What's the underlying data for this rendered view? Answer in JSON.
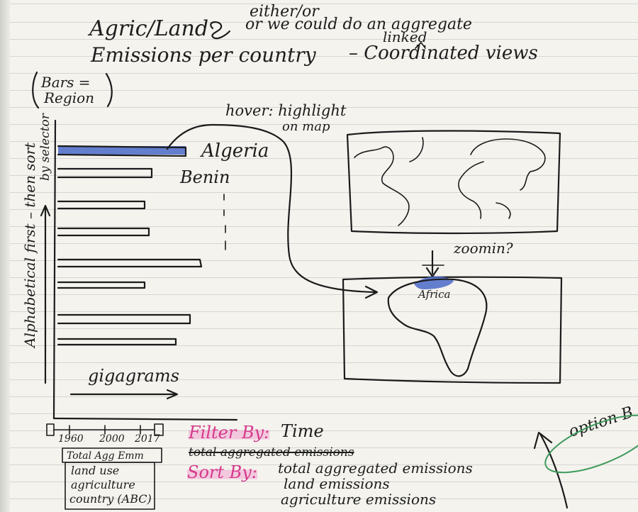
{
  "title": {
    "line1": "Agric/Land",
    "either_or_top": "either/or",
    "either_or_bottom": "or we could do an aggregate",
    "linked": "linked",
    "line2_left": "Emissions per country",
    "coordinated_views": "– Coordinated views"
  },
  "bars_note": {
    "line1": "Bars =",
    "line2": "Region"
  },
  "hover_note": {
    "line1": "hover: highlight",
    "line2": "on map"
  },
  "bar_labels": {
    "first": "Algeria",
    "second": "Benin"
  },
  "y_axis_note": "Alphabetical first – then sort",
  "y_axis_note2": "by selector",
  "x_axis_label": "gigagrams",
  "zoom_note": "zoomin?",
  "map_label": "Africa",
  "time_ticks": [
    "1960",
    "2000",
    "2017"
  ],
  "dropdown": {
    "selected": "Total Agg Emm",
    "options": [
      "land use",
      "agriculture",
      "country (ABC)"
    ]
  },
  "filter_label": "Filter By:",
  "filter_value": "Time",
  "struck_text": "total aggregated emissions",
  "sort_label": "Sort By:",
  "sort_options": [
    "total aggregated emissions",
    "land emissions",
    "agriculture emissions"
  ],
  "option_label": "option B",
  "colors": {
    "highlight": "#4a68c8",
    "pink": "#d63a8c",
    "green": "#3f9a5c",
    "ink": "#1b1b1b"
  }
}
